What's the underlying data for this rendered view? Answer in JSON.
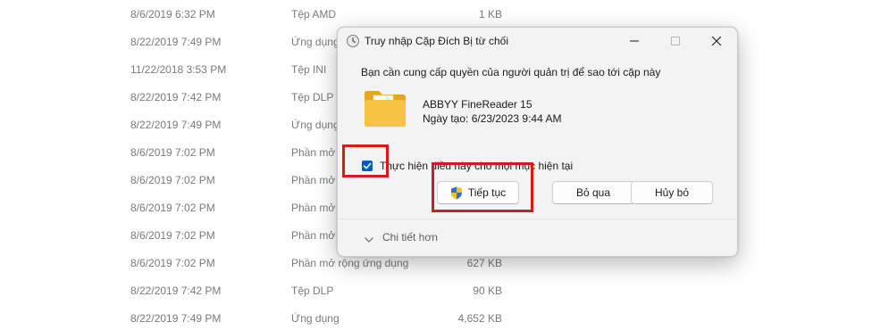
{
  "file_list": {
    "rows": [
      {
        "date": "8/6/2019 6:32 PM",
        "type": "Tệp AMD",
        "size": "1 KB"
      },
      {
        "date": "8/22/2019 7:49 PM",
        "type": "Ứng dụng",
        "size": ""
      },
      {
        "date": "11/22/2018 3:53 PM",
        "type": "Tệp INI",
        "size": ""
      },
      {
        "date": "8/22/2019 7:42 PM",
        "type": "Tệp DLP",
        "size": ""
      },
      {
        "date": "8/22/2019 7:49 PM",
        "type": "Ứng dụng",
        "size": ""
      },
      {
        "date": "8/6/2019 7:02 PM",
        "type": "Phần mở",
        "size": ""
      },
      {
        "date": "8/6/2019 7:02 PM",
        "type": "Phần mở",
        "size": ""
      },
      {
        "date": "8/6/2019 7:02 PM",
        "type": "Phần mở",
        "size": ""
      },
      {
        "date": "8/6/2019 7:02 PM",
        "type": "Phần mở",
        "size": ""
      },
      {
        "date": "8/6/2019 7:02 PM",
        "type": "Phần mở rộng ứng dụng",
        "size": "627 KB"
      },
      {
        "date": "8/22/2019 7:42 PM",
        "type": "Tệp DLP",
        "size": "90 KB"
      },
      {
        "date": "8/22/2019 7:49 PM",
        "type": "Ứng dụng",
        "size": "4,652 KB"
      }
    ]
  },
  "dialog": {
    "title": "Truy nhập Cặp Đích Bị từ chối",
    "message": "Bạn cần cung cấp quyền của người quản trị để sao tới cặp này",
    "item_name": "ABBYY FineReader 15",
    "item_date": "Ngày tạo: 6/23/2023 9:44 AM",
    "checkbox_label": "Thực hiện điều này cho mọi mục hiện tại",
    "checkbox_checked": true,
    "buttons": {
      "continue": "Tiếp tục",
      "skip": "Bỏ qua",
      "cancel": "Hủy bỏ"
    },
    "details_label": "Chi tiết hơn"
  },
  "icons": {
    "title": "clock-icon",
    "minimize": "minimize-icon",
    "maximize": "maximize-icon",
    "close": "close-icon",
    "folder": "folder-icon",
    "shield": "shield-icon",
    "chevron": "chevron-down-icon",
    "check": "checkmark-icon"
  },
  "colors": {
    "accent": "#005fb8",
    "highlight": "#d61a1a",
    "folder": "#f6c343"
  }
}
